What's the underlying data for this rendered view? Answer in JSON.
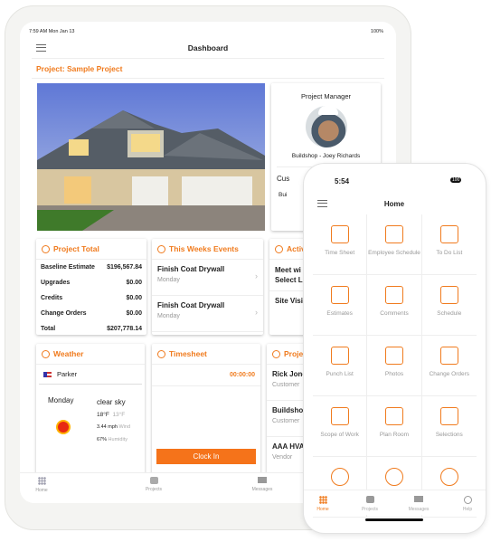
{
  "tablet": {
    "status": {
      "time": "7:59 AM  Mon Jan 13",
      "battery": "100%"
    },
    "header": {
      "title": "Dashboard"
    },
    "project_title": "Project: Sample Project",
    "manager": {
      "heading": "Project Manager",
      "name": "Buildshop - Joey Richards",
      "customer_partial": "Cus",
      "customer_name_partial": "Bui"
    },
    "project_total": {
      "title": "Project Total",
      "rows": [
        {
          "label": "Baseline Estimate",
          "value": "$196,567.84"
        },
        {
          "label": "Upgrades",
          "value": "$0.00"
        },
        {
          "label": "Credits",
          "value": "$0.00"
        },
        {
          "label": "Change Orders",
          "value": "$0.00"
        },
        {
          "label": "Total",
          "value": "$207,778.14"
        }
      ]
    },
    "events": {
      "title": "This Weeks Events",
      "items": [
        {
          "title": "Finish Coat Drywall",
          "day": "Monday"
        },
        {
          "title": "Finish Coat Drywall",
          "day": "Monday"
        }
      ]
    },
    "activity": {
      "title": "Activ",
      "items": [
        "Meet wi",
        "Select Li",
        "Site Visi"
      ]
    },
    "weather": {
      "title": "Weather",
      "location": "Parker",
      "day": "Monday",
      "condition": "clear sky",
      "high": "18°F",
      "low": "13°F",
      "wind": "3.44 mph",
      "wind_label": "Wind",
      "humidity": "67%",
      "humidity_label": "Humidity"
    },
    "timesheet": {
      "title": "Timesheet",
      "timer": "00:00:00",
      "button": "Clock In"
    },
    "contacts": {
      "title": "Proje",
      "items": [
        {
          "name": "Rick Jone",
          "role": "Customer"
        },
        {
          "name": "Buildsho",
          "role": "Customer"
        },
        {
          "name": "AAA HVA",
          "role": "Vendor"
        }
      ]
    },
    "tabs": [
      "Home",
      "Projects",
      "Messages"
    ]
  },
  "phone": {
    "status": {
      "time": "5:54",
      "battery": "100"
    },
    "header": {
      "title": "Home"
    },
    "tiles": [
      {
        "label": "Time Sheet",
        "icon": "clipboard-pen-icon"
      },
      {
        "label": "Employee Schedule",
        "icon": "employee-clock-icon"
      },
      {
        "label": "To Do List",
        "icon": "notepad-icon"
      },
      {
        "label": "Estimates",
        "icon": "calculator-icon"
      },
      {
        "label": "Comments",
        "icon": "chat-bubbles-icon"
      },
      {
        "label": "Schedule",
        "icon": "calendar-icon"
      },
      {
        "label": "Punch List",
        "icon": "checklist-icon"
      },
      {
        "label": "Photos",
        "icon": "image-icon"
      },
      {
        "label": "Change Orders",
        "icon": "swap-arrows-icon"
      },
      {
        "label": "Scope of Work",
        "icon": "target-icon"
      },
      {
        "label": "Plan Room",
        "icon": "ruler-pencil-icon"
      },
      {
        "label": "Selections",
        "icon": "swatches-icon"
      },
      {
        "label": "",
        "icon": "user-icon"
      },
      {
        "label": "",
        "icon": "user-circle-icon"
      },
      {
        "label": "",
        "icon": "users-icon"
      }
    ],
    "tabs": [
      "Home",
      "Projects",
      "Messages",
      "Help"
    ],
    "accent": "#f07b1e"
  }
}
